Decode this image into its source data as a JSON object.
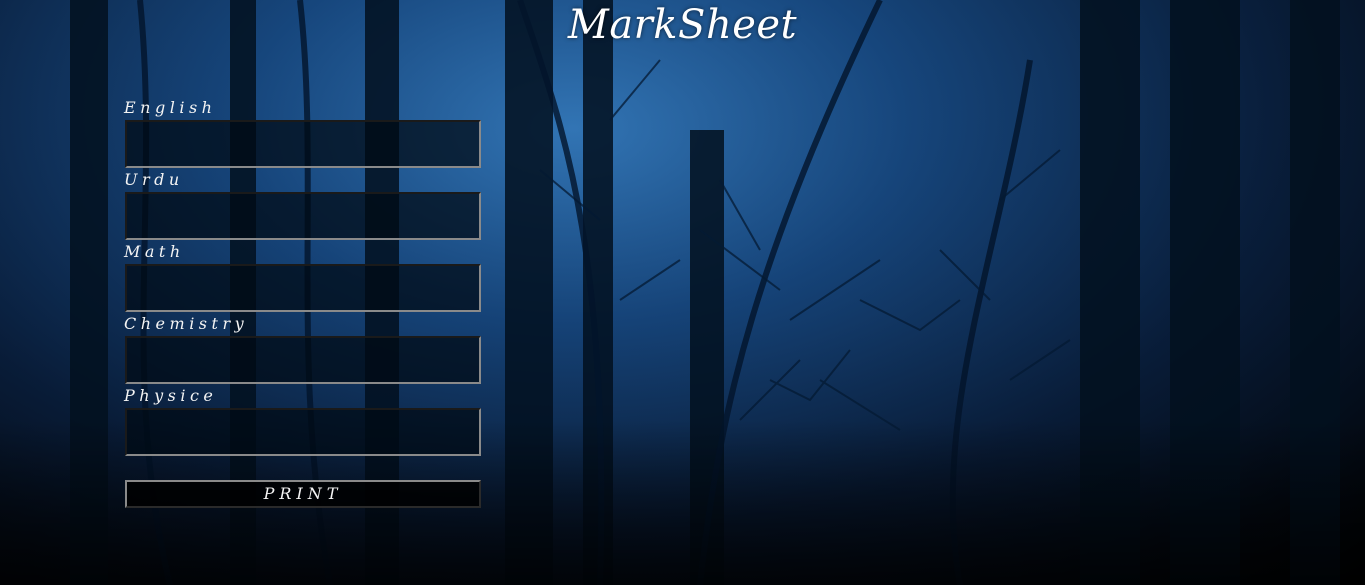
{
  "page": {
    "title": "MarkSheet"
  },
  "form": {
    "fields": [
      {
        "label": "English",
        "value": ""
      },
      {
        "label": "Urdu",
        "value": ""
      },
      {
        "label": "Math",
        "value": ""
      },
      {
        "label": "Chemistry",
        "value": ""
      },
      {
        "label": "Physice",
        "value": ""
      }
    ],
    "print_label": "PRINT"
  },
  "theme": {
    "background": "#0d3d6b",
    "text": "#ffffff",
    "input_bg": "#000a14"
  },
  "icons": {
    "background_image": "dark-forest-image"
  }
}
